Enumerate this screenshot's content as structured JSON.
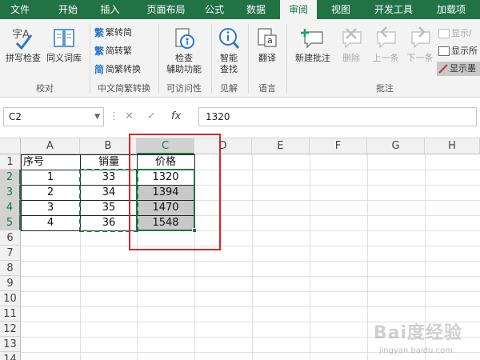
{
  "ribbon_tabs": [
    {
      "label": "文件"
    },
    {
      "label": "开始"
    },
    {
      "label": "插入"
    },
    {
      "label": "页面布局"
    },
    {
      "label": "公式"
    },
    {
      "label": "数据"
    },
    {
      "label": "审阅"
    },
    {
      "label": "视图"
    },
    {
      "label": "开发工具"
    },
    {
      "label": "加载项"
    }
  ],
  "active_tab": "审阅",
  "ribbon": {
    "proofing": {
      "spell_icon_text": "字A",
      "spell_check": "拼写检查",
      "thesaurus": "同义词库",
      "group": "校对"
    },
    "chinese": {
      "trad_icon": "繁",
      "simp_icon": "繁",
      "conv_icon": "简",
      "to_traditional": "繁转简",
      "to_simplified": "简转繁",
      "convert": "简繁转换",
      "group": "中文简繁转换"
    },
    "accessibility": {
      "check_line1": "检查",
      "check_line2": "辅助功能",
      "group": "可访问性"
    },
    "insights": {
      "smart_line1": "智能",
      "smart_line2": "查找",
      "group": "见解"
    },
    "language": {
      "translate_icon_text": "a",
      "translate": "翻译",
      "group": "语言"
    },
    "comments": {
      "new": "新建批注",
      "delete": "删除",
      "prev": "上一条",
      "next": "下一条",
      "show_hide": "显示/",
      "show_all": "显示所",
      "show_ink": "显示墨",
      "group": "批注"
    }
  },
  "formula_bar": {
    "name_box": "C2",
    "dropdown": "▼",
    "dots": "⋮",
    "cancel": "✕",
    "enter": "✓",
    "fx": "fx",
    "value": "1320"
  },
  "sheet": {
    "columns": [
      "A",
      "B",
      "C",
      "D",
      "E",
      "F",
      "G",
      "H"
    ],
    "rows": [
      "1",
      "2",
      "3",
      "4",
      "5",
      "6",
      "7",
      "8",
      "9",
      "10",
      "11",
      "12",
      "13",
      "14"
    ],
    "cells": {
      "A1": "序号",
      "B1": "销量",
      "C1": "价格",
      "A2": "1",
      "B2": "33",
      "C2": "1320",
      "A3": "2",
      "B3": "34",
      "C3": "1394",
      "A4": "3",
      "B4": "35",
      "C4": "1470",
      "A5": "4",
      "B5": "36",
      "C5": "1548"
    },
    "selected_cell": "C2"
  },
  "watermark": {
    "main": "Bai度经验",
    "sub": "jingyan.baidu.com"
  },
  "colors": {
    "accent": "#217346",
    "annotation_red": "#d8232a"
  }
}
